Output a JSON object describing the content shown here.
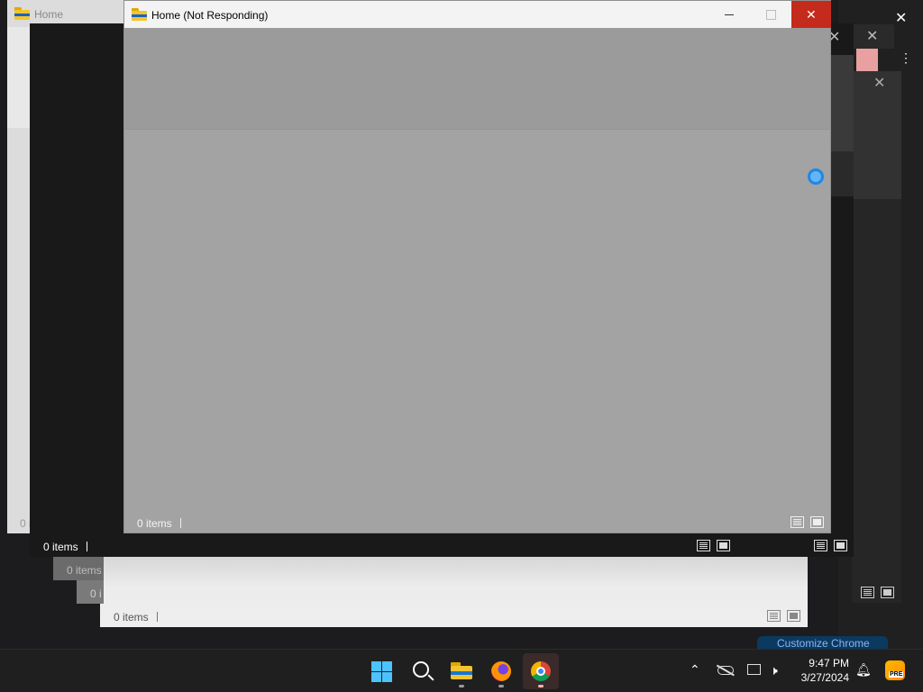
{
  "windows": {
    "back_left": {
      "title": "Home",
      "status": "0 i"
    },
    "main": {
      "title": "Home (Not Responding)",
      "status": "0 items"
    },
    "second": {
      "status": "0 items"
    },
    "third": {
      "status": "0 items"
    },
    "fourth": {
      "status": "0 i"
    },
    "fifth": {
      "status": "0 items"
    }
  },
  "chrome_notification": {
    "text": "Customize Chrome"
  },
  "caption_buttons": {
    "minimize": "—",
    "maximize": "☐",
    "close": "✕"
  },
  "taskbar": {
    "apps": [
      {
        "name": "Start",
        "icon": "windows-start-icon"
      },
      {
        "name": "Search",
        "icon": "search-icon"
      },
      {
        "name": "File Explorer",
        "icon": "file-explorer-icon"
      },
      {
        "name": "Firefox",
        "icon": "firefox-icon"
      },
      {
        "name": "Google Chrome",
        "icon": "chrome-icon"
      }
    ],
    "tray": {
      "time": "9:47 PM",
      "date": "3/27/2024",
      "icons": [
        "chevron-up-icon",
        "onedrive-offline-icon",
        "network-icon",
        "volume-muted-icon",
        "notification-bell-icon",
        "copilot-pre-icon"
      ]
    }
  },
  "colors": {
    "desktop": "#1c1c1e",
    "not_responding_overlay": "#a3a3a3",
    "close_red": "#c42b1c",
    "taskbar": "#1f1f1f"
  }
}
